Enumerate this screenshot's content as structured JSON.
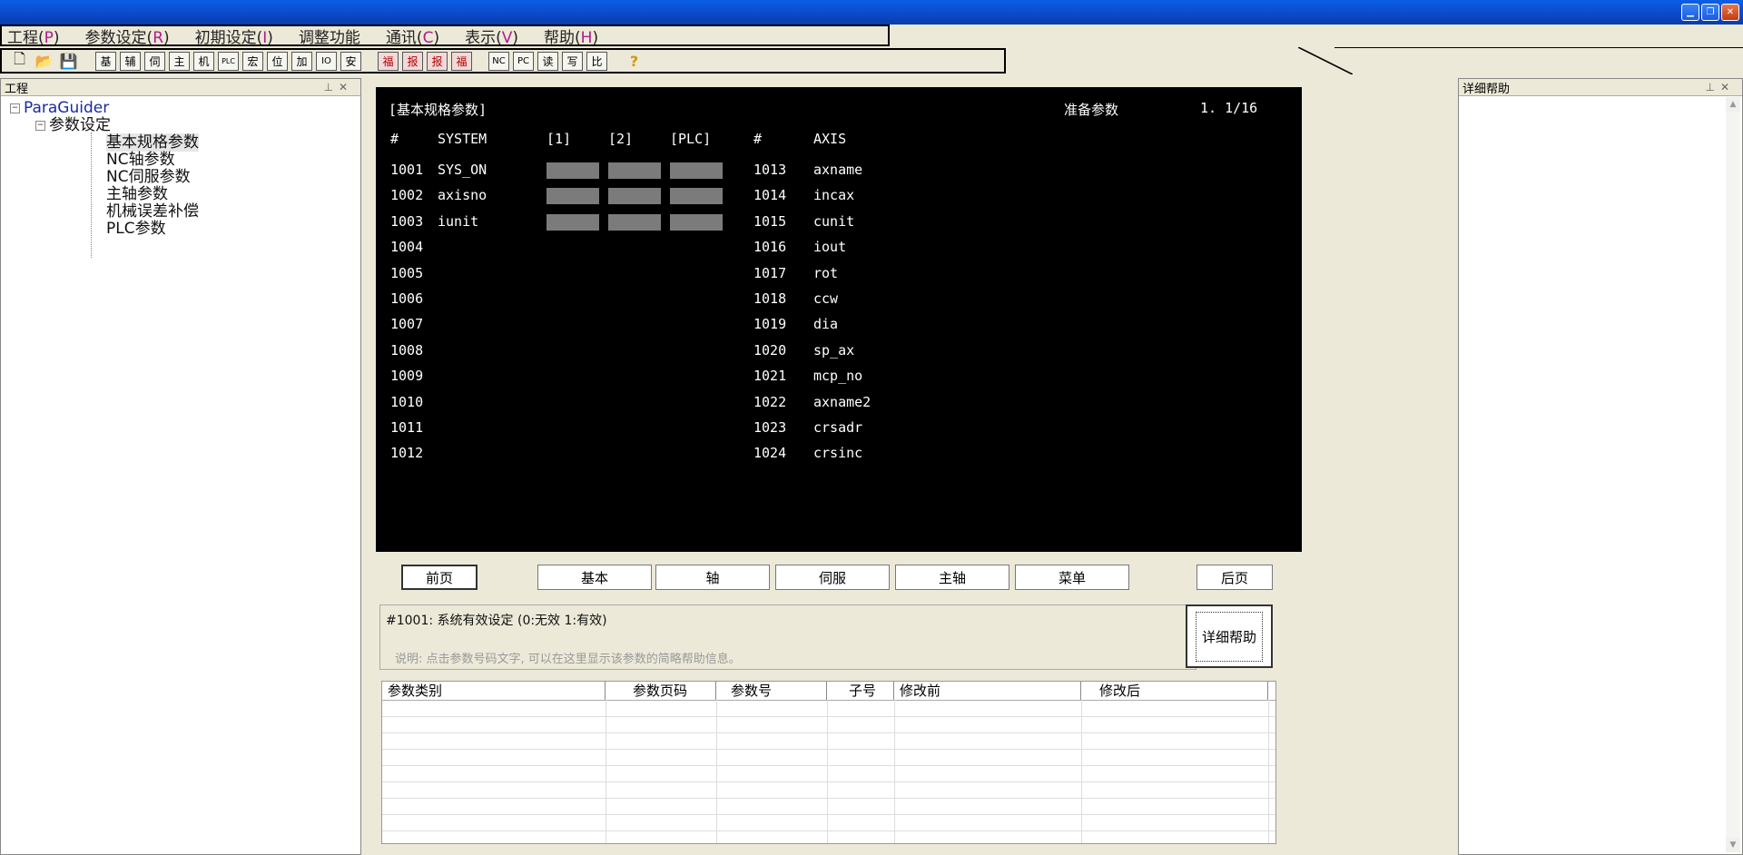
{
  "menu": {
    "items": [
      {
        "label": "工程(",
        "key": "P",
        "close": ")"
      },
      {
        "label": "参数设定(",
        "key": "R",
        "close": ")"
      },
      {
        "label": "初期设定(",
        "key": "I",
        "close": ")"
      },
      {
        "label": "调整功能",
        "key": "",
        "close": ""
      },
      {
        "label": "通讯(",
        "key": "C",
        "close": ")"
      },
      {
        "label": "表示(",
        "key": "V",
        "close": ")"
      },
      {
        "label": "帮助(",
        "key": "H",
        "close": ")"
      }
    ]
  },
  "toolbar": {
    "group1": [
      "基",
      "辅",
      "伺",
      "主",
      "机",
      "PLC",
      "宏",
      "位",
      "加",
      "IO",
      "安"
    ],
    "group2": [
      "福",
      "报",
      "报",
      "福"
    ],
    "group3": [
      "NC",
      "PC",
      "读",
      "写",
      "比"
    ],
    "help": "?"
  },
  "project_panel": {
    "title": "工程",
    "root": "ParaGuider",
    "group": "参数设定",
    "items": [
      "基本规格参数",
      "NC轴参数",
      "NC伺服参数",
      "主轴参数",
      "机械误差补偿",
      "PLC参数"
    ]
  },
  "screen": {
    "title": "[基本规格参数]",
    "mode": "准备参数",
    "page": "1. 1/16",
    "headers": {
      "num": "#",
      "system": "SYSTEM",
      "c1": "[1]",
      "c2": "[2]",
      "plc": "[PLC]",
      "num2": "#",
      "axis": "AXIS"
    },
    "left_rows": [
      {
        "num": "1001",
        "name": "SYS_ON"
      },
      {
        "num": "1002",
        "name": "axisno"
      },
      {
        "num": "1003",
        "name": "iunit"
      },
      {
        "num": "1004",
        "name": ""
      },
      {
        "num": "1005",
        "name": ""
      },
      {
        "num": "1006",
        "name": ""
      },
      {
        "num": "1007",
        "name": ""
      },
      {
        "num": "1008",
        "name": ""
      },
      {
        "num": "1009",
        "name": ""
      },
      {
        "num": "1010",
        "name": ""
      },
      {
        "num": "1011",
        "name": ""
      },
      {
        "num": "1012",
        "name": ""
      }
    ],
    "right_rows": [
      {
        "num": "1013",
        "name": "axname"
      },
      {
        "num": "1014",
        "name": "incax"
      },
      {
        "num": "1015",
        "name": "cunit"
      },
      {
        "num": "1016",
        "name": "iout"
      },
      {
        "num": "1017",
        "name": "rot"
      },
      {
        "num": "1018",
        "name": "ccw"
      },
      {
        "num": "1019",
        "name": "dia"
      },
      {
        "num": "1020",
        "name": "sp_ax"
      },
      {
        "num": "1021",
        "name": "mcp_no"
      },
      {
        "num": "1022",
        "name": "axname2"
      },
      {
        "num": "1023",
        "name": "crsadr"
      },
      {
        "num": "1024",
        "name": "crsinc"
      }
    ]
  },
  "nav": {
    "prev": "前页",
    "basic": "基本",
    "axis": "轴",
    "servo": "伺服",
    "spindle": "主轴",
    "menu": "菜单",
    "next": "后页"
  },
  "info": {
    "line1": "#1001: 系统有效设定 (0:无效 1:有效)",
    "line2": "说明: 点击参数号码文字, 可以在这里显示该参数的简略帮助信息。",
    "detail_button": "详细帮助"
  },
  "history": {
    "columns": [
      "参数类别",
      "参数页码",
      "参数号",
      "子号",
      "修改前",
      "修改后",
      ""
    ]
  },
  "help_panel": {
    "title": "详细帮助"
  }
}
